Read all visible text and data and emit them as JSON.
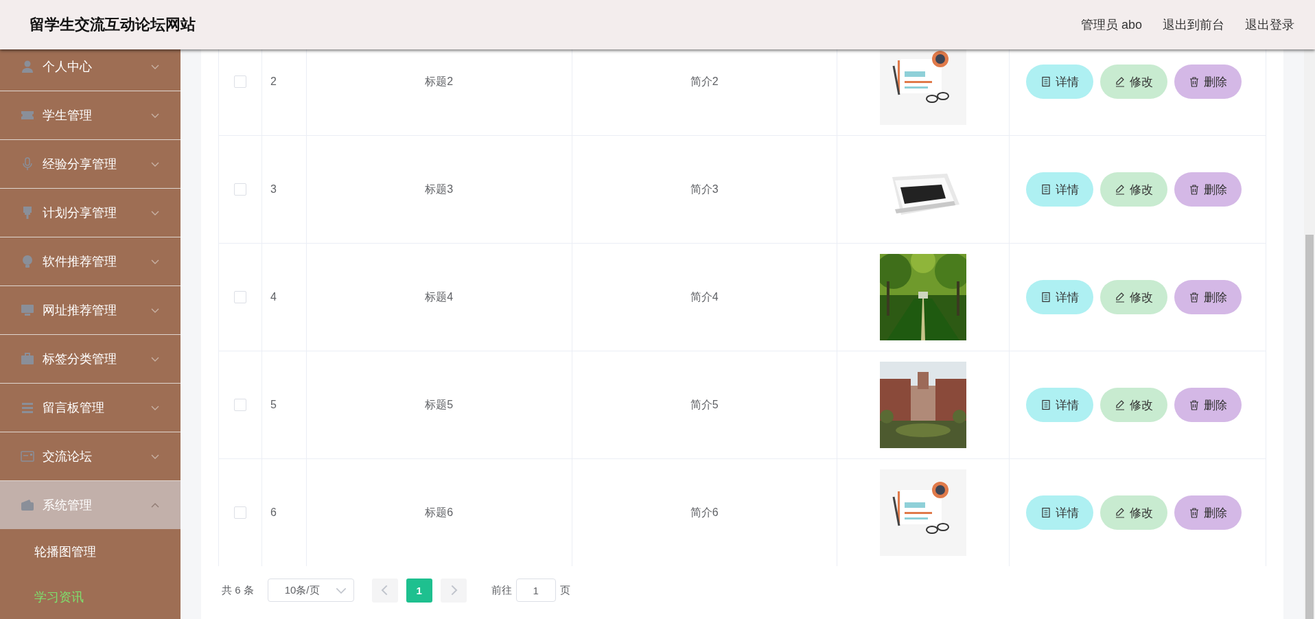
{
  "header": {
    "title": "留学生交流互动论坛网站",
    "links": [
      "管理员 abo",
      "退出到前台",
      "退出登录"
    ]
  },
  "sidebar": {
    "items": [
      {
        "label": "个人中心",
        "expanded": false
      },
      {
        "label": "学生管理",
        "expanded": false
      },
      {
        "label": "经验分享管理",
        "expanded": false
      },
      {
        "label": "计划分享管理",
        "expanded": false
      },
      {
        "label": "软件推荐管理",
        "expanded": false
      },
      {
        "label": "网址推荐管理",
        "expanded": false
      },
      {
        "label": "标签分类管理",
        "expanded": false
      },
      {
        "label": "留言板管理",
        "expanded": false
      },
      {
        "label": "交流论坛",
        "expanded": false
      },
      {
        "label": "系统管理",
        "expanded": true,
        "children": [
          {
            "label": "轮播图管理",
            "selected": false
          },
          {
            "label": "学习资讯",
            "selected": true
          }
        ]
      }
    ]
  },
  "table": {
    "rows": [
      {
        "checked": false,
        "index": "2",
        "title": "标题2",
        "intro": "简介2",
        "actions": [
          {
            "kind": "detail",
            "label": "详情"
          },
          {
            "kind": "edit",
            "label": "修改"
          },
          {
            "kind": "delete",
            "label": "删除"
          }
        ]
      },
      {
        "checked": false,
        "index": "3",
        "title": "标题3",
        "intro": "简介3",
        "actions": [
          {
            "kind": "detail",
            "label": "详情"
          },
          {
            "kind": "edit",
            "label": "修改"
          },
          {
            "kind": "delete",
            "label": "删除"
          }
        ]
      },
      {
        "checked": false,
        "index": "4",
        "title": "标题4",
        "intro": "简介4",
        "actions": [
          {
            "kind": "detail",
            "label": "详情"
          },
          {
            "kind": "edit",
            "label": "修改"
          },
          {
            "kind": "delete",
            "label": "删除"
          }
        ]
      },
      {
        "checked": false,
        "index": "5",
        "title": "标题5",
        "intro": "简介5",
        "actions": [
          {
            "kind": "detail",
            "label": "详情"
          },
          {
            "kind": "edit",
            "label": "修改"
          },
          {
            "kind": "delete",
            "label": "删除"
          }
        ]
      },
      {
        "checked": false,
        "index": "6",
        "title": "标题6",
        "intro": "简介6",
        "actions": [
          {
            "kind": "detail",
            "label": "详情"
          },
          {
            "kind": "edit",
            "label": "修改"
          },
          {
            "kind": "delete",
            "label": "删除"
          }
        ]
      }
    ]
  },
  "pagination": {
    "total": "共 6 条",
    "page_size": "10条/页",
    "pages": [
      {
        "label": "1",
        "selected": true
      }
    ],
    "goto_label": "前往",
    "goto_value": "1",
    "page_suffix": "页"
  }
}
